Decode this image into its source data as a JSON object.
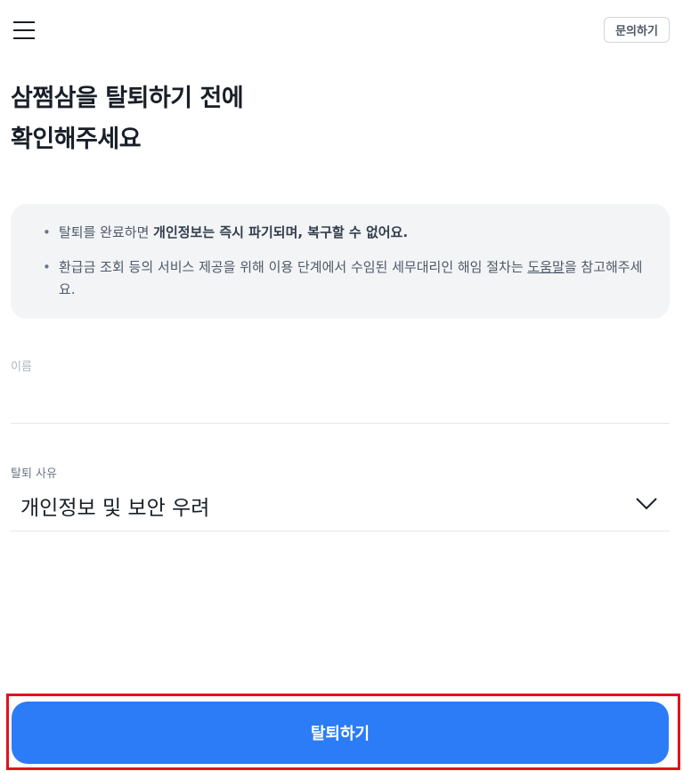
{
  "header": {
    "menu_icon": "hamburger-menu-icon",
    "inquiry_label": "문의하기"
  },
  "title": {
    "line1": "삼쩜삼을 탈퇴하기 전에",
    "line2": "확인해주세요"
  },
  "notice": {
    "item1": {
      "prefix": "탈퇴를 완료하면 ",
      "bold": "개인정보는 즉시 파기되며, 복구할 수 없어요."
    },
    "item2": {
      "prefix": "환급금 조회 등의 서비스 제공을 위해 이용 단계에서 수임된 세무대리인 해임 절차는 ",
      "link": "도움말",
      "suffix": "을 참고해주세요."
    }
  },
  "form": {
    "name_label": "이름",
    "name_value": "",
    "reason_label": "탈퇴 사유",
    "reason_value": "개인정보 및 보안 우려",
    "reason_icon": "chevron-down-icon"
  },
  "footer": {
    "withdraw_label": "탈퇴하기",
    "accent_color": "#2b7cf6",
    "highlight_color": "#e3121b"
  }
}
